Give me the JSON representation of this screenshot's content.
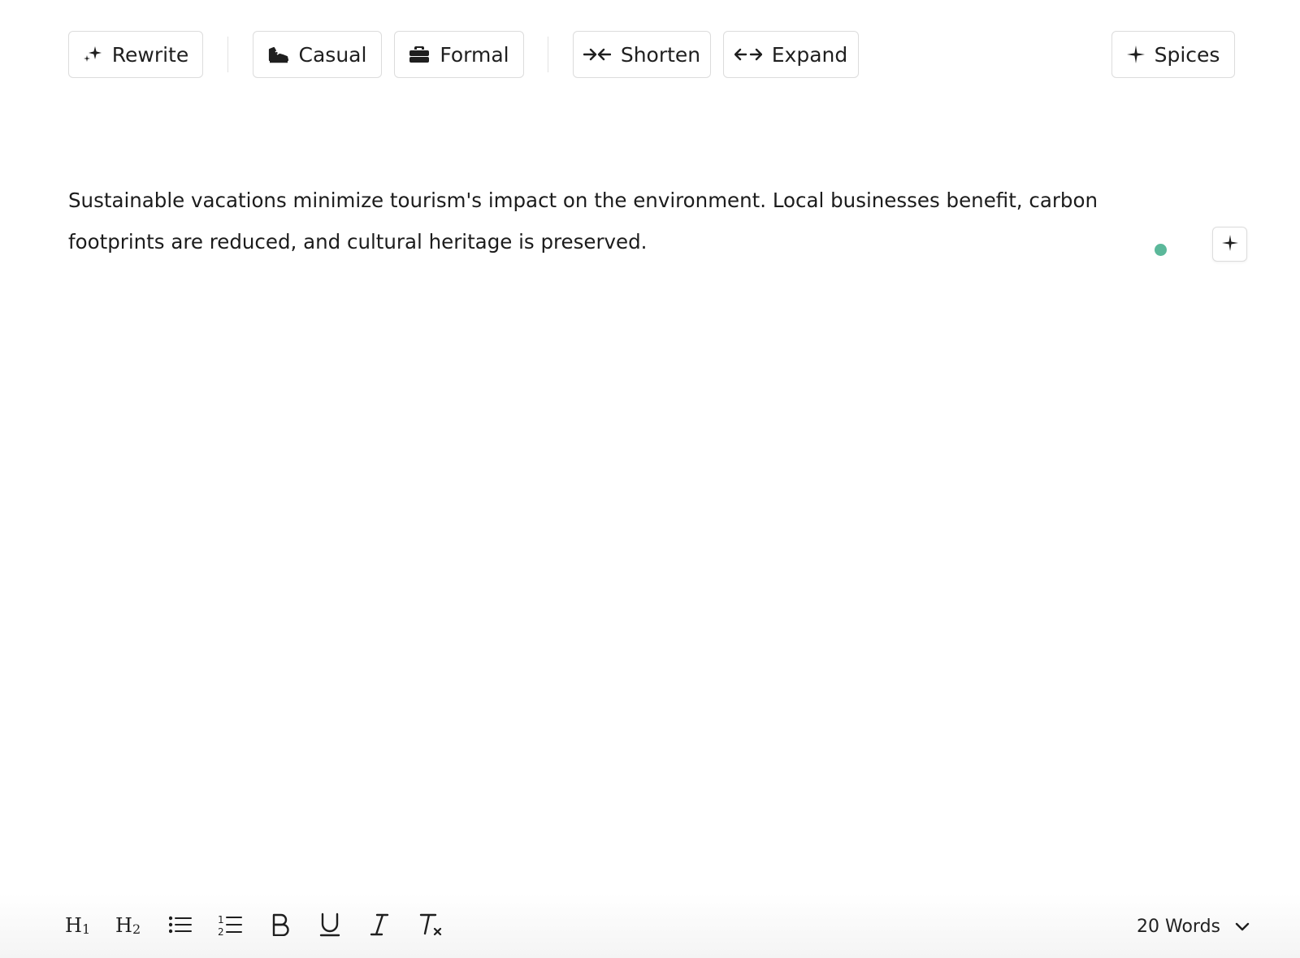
{
  "toolbar": {
    "rewrite": {
      "label": "Rewrite",
      "icon": "sparkle-icon"
    },
    "casual": {
      "label": "Casual",
      "icon": "sneaker-icon"
    },
    "formal": {
      "label": "Formal",
      "icon": "briefcase-icon"
    },
    "shorten": {
      "label": "Shorten",
      "icon": "arrows-inward-icon"
    },
    "expand": {
      "label": "Expand",
      "icon": "arrows-outward-icon"
    },
    "spices": {
      "label": "Spices",
      "icon": "plus-sparkle-icon"
    }
  },
  "editor": {
    "text": "Sustainable vacations minimize tourism's impact on the environment. Local businesses benefit, carbon footprints are reduced, and cultural heritage is preserved."
  },
  "status": {
    "dot_color": "#5bb89a"
  },
  "format_bar": {
    "items": [
      {
        "name": "heading-1",
        "icon": "h1-icon"
      },
      {
        "name": "heading-2",
        "icon": "h2-icon"
      },
      {
        "name": "bullet-list",
        "icon": "bullet-list-icon"
      },
      {
        "name": "numbered-list",
        "icon": "numbered-list-icon"
      },
      {
        "name": "bold",
        "icon": "bold-icon"
      },
      {
        "name": "underline",
        "icon": "underline-icon"
      },
      {
        "name": "italic",
        "icon": "italic-icon"
      },
      {
        "name": "clear-format",
        "icon": "clear-format-icon"
      }
    ],
    "word_count": "20 Words"
  }
}
